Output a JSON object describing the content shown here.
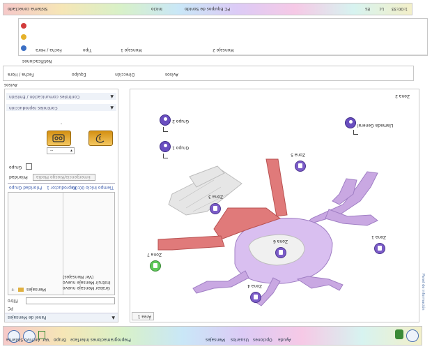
{
  "colors": {
    "accent": "#4a70b0",
    "zone_purple": "#c7a6e2",
    "zone_red": "#e07a7a",
    "terminal_gray": "#e2e2e2",
    "button_gold": "#e3a52a",
    "node_purple": "#7b5cc8",
    "node_green": "#5fc95a"
  },
  "menu": {
    "items": [
      "Sistema",
      "Archivo",
      "Ver",
      "Grupo",
      "Preprogramaciones Interface",
      "Mensajes",
      "Usuarios",
      "Opciones",
      "Ayuda"
    ]
  },
  "map": {
    "tab_label": "Área 1",
    "right_tab_label": "Panel de información",
    "zones": [
      {
        "label": "Zona 1"
      },
      {
        "label": "Zona 2"
      },
      {
        "label": "Zona 3"
      },
      {
        "label": "Zona 4"
      },
      {
        "label": "Zona 5"
      },
      {
        "label": "Zona 6"
      },
      {
        "label": "Zona 7"
      }
    ],
    "groups": [
      {
        "label": "Grupo 1"
      },
      {
        "label": "Grupo 2"
      },
      {
        "label": "Llamada General"
      }
    ]
  },
  "left_panel": {
    "title": "Panel de Mensajes",
    "pc_label": "PC",
    "filter_label": "Filtro",
    "messages_label": "Mensajes",
    "list_item_1": "Grabar Mensaje nuevo",
    "list_item_2": "Instruir Mensaje nuevo",
    "list_item_3": "(Ver Mensajes)",
    "tabs": [
      "Prioridad Grupo",
      "Reproductor 1",
      "Tiempo Inicio 00:00"
    ],
    "priority_label": "Prioridad",
    "priority_value": "Emergencia/Riesgo Media",
    "group_label": "Grupo",
    "combo_value": "--",
    "section_1": "Controles reproducción",
    "section_2": "Controles comunicación / Emisión"
  },
  "log_panel": {
    "tab_label": "Avisos",
    "columns": [
      "Fecha / Hora",
      "Equipo",
      "Dirección",
      "Avisos"
    ]
  },
  "events_panel": {
    "tab_label": "Notificaciones",
    "columns": [
      "Fecha / Hora",
      "Tipo",
      "Mensaje 1",
      "Mensaje 2"
    ]
  },
  "status_bar": {
    "left": "Sistema conectado",
    "middle": "PC Equipos de Sonido",
    "right": "Inicio",
    "values": [
      "Es",
      "Lc",
      "1:00:33"
    ]
  }
}
